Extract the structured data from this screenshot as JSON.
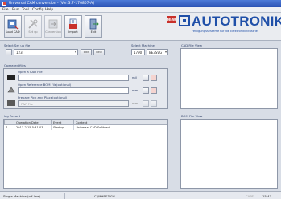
{
  "window": {
    "title": "Universal CAM conversion - [Ver:3.7-170807-A]"
  },
  "menu": [
    "File",
    "Run",
    "Tool",
    "Config",
    "Help"
  ],
  "toolbar": {
    "buttons": [
      {
        "label": "Load CAD",
        "icon": "cad-icon"
      },
      {
        "label": "Set up",
        "icon": "tools-icon"
      },
      {
        "label": "Conversion",
        "icon": "convert-icon"
      },
      {
        "label": "Import",
        "icon": "import-icon"
      },
      {
        "label": "Exit",
        "icon": "exit-icon"
      }
    ]
  },
  "brand": {
    "badge": "NEW",
    "name": "AUTOTRONIK",
    "tagline": "Fertigungssysteme für die Elektronikindustrie",
    "color": "#1f4fa8"
  },
  "setup": {
    "select_label": "Select Set up file",
    "file_value": "123",
    "edit_button": "Edit",
    "new_button": "New",
    "machine_label": "Select Machine",
    "machine_model": "1790",
    "machine_id": "BE3SVG"
  },
  "files": {
    "section_label": "Operated files",
    "cad_label": "Open a CAD File",
    "cad_unit": "mil",
    "ref_label": "Open Reference BOM File(optional)",
    "ref_unit": "mm",
    "pnp_label": "Prepare Pick and Place(optional)",
    "pnp_placeholder": "P&P File",
    "pnp_unit": "mm"
  },
  "log": {
    "section_label": "log Record",
    "columns": [
      "",
      "Operation Date",
      "Event",
      "Content"
    ],
    "rows": [
      {
        "num": "1",
        "date": "2013-2-15 5:41:03...",
        "event": "Startup",
        "content": "Universal CAD Softhlect"
      }
    ]
  },
  "panels": {
    "cad_view": "CAD File View",
    "bom_view": "BOM File View"
  },
  "status": {
    "mode": "Single Machine (off line)",
    "path": "C:\\MHBE3\\GG",
    "caps": "CAPS",
    "time": "15:47"
  }
}
